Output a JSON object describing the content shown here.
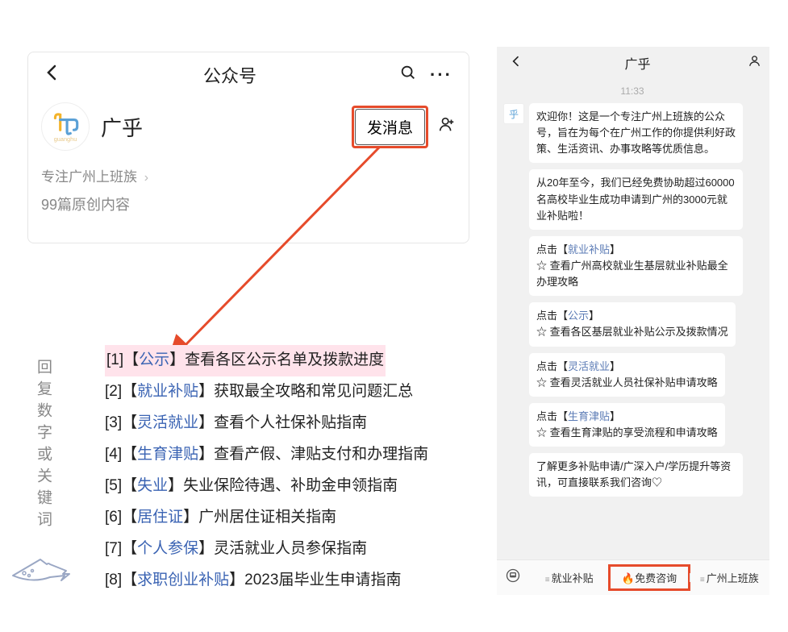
{
  "profile": {
    "header_title": "公众号",
    "account_name": "广乎",
    "msg_button": "发消息",
    "tagline": "专注广州上班族",
    "articles_line": "99篇原创内容"
  },
  "reply_label": "回复数字或关键词",
  "reply_list": [
    {
      "idx": "[1]",
      "kw": "公示",
      "desc": "查看各区公示名单及拨款进度",
      "highlight": true
    },
    {
      "idx": "[2]",
      "kw": "就业补贴",
      "desc": "获取最全攻略和常见问题汇总",
      "highlight": false
    },
    {
      "idx": "[3]",
      "kw": "灵活就业",
      "desc": "查看个人社保补贴指南",
      "highlight": false
    },
    {
      "idx": "[4]",
      "kw": "生育津贴",
      "desc": "查看产假、津贴支付和办理指南",
      "highlight": false
    },
    {
      "idx": "[5]",
      "kw": "失业",
      "desc": "失业保险待遇、补助金申领指南",
      "highlight": false
    },
    {
      "idx": "[6]",
      "kw": "居住证",
      "desc": "广州居住证相关指南",
      "highlight": false
    },
    {
      "idx": "[7]",
      "kw": "个人参保",
      "desc": "灵活就业人员参保指南",
      "highlight": false
    },
    {
      "idx": "[8]",
      "kw": "求职创业补贴",
      "desc": "2023届毕业生申请指南",
      "highlight": false
    }
  ],
  "chat": {
    "title": "广乎",
    "time": "11:33",
    "avatar_glyph": "乎",
    "welcome": "欢迎你！这是一个专注广州上班族的公众号，旨在为每个在广州工作的你提供利好政策、生活资讯、办事攻略等优质信息。",
    "stats": "从20年至今，我们已经免费协助超过60000名高校毕业生成功申请到广州的3000元就业补贴啦！",
    "blocks": [
      {
        "prefix": "点击【",
        "link": "就业补贴",
        "suffix": "】",
        "note": "☆ 查看广州高校就业生基层就业补贴最全办理攻略"
      },
      {
        "prefix": "点击【",
        "link": "公示",
        "suffix": "】",
        "note": "☆ 查看各区基层就业补贴公示及拨款情况"
      },
      {
        "prefix": "点击【",
        "link": "灵活就业",
        "suffix": "】",
        "note": "☆ 查看灵活就业人员社保补贴申请攻略"
      },
      {
        "prefix": "点击【",
        "link": "生育津贴",
        "suffix": "】",
        "note": "☆ 查看生育津贴的享受流程和申请攻略"
      }
    ],
    "more": "了解更多补贴申请/广深入户/学历提升等资讯，可直接联系我们咨询♡",
    "menu": [
      {
        "label": "就业补贴",
        "dot": true,
        "fire": false,
        "highlight": false
      },
      {
        "label": "免费咨询",
        "dot": false,
        "fire": true,
        "highlight": true
      },
      {
        "label": "广州上班族",
        "dot": true,
        "fire": false,
        "highlight": false
      }
    ]
  }
}
